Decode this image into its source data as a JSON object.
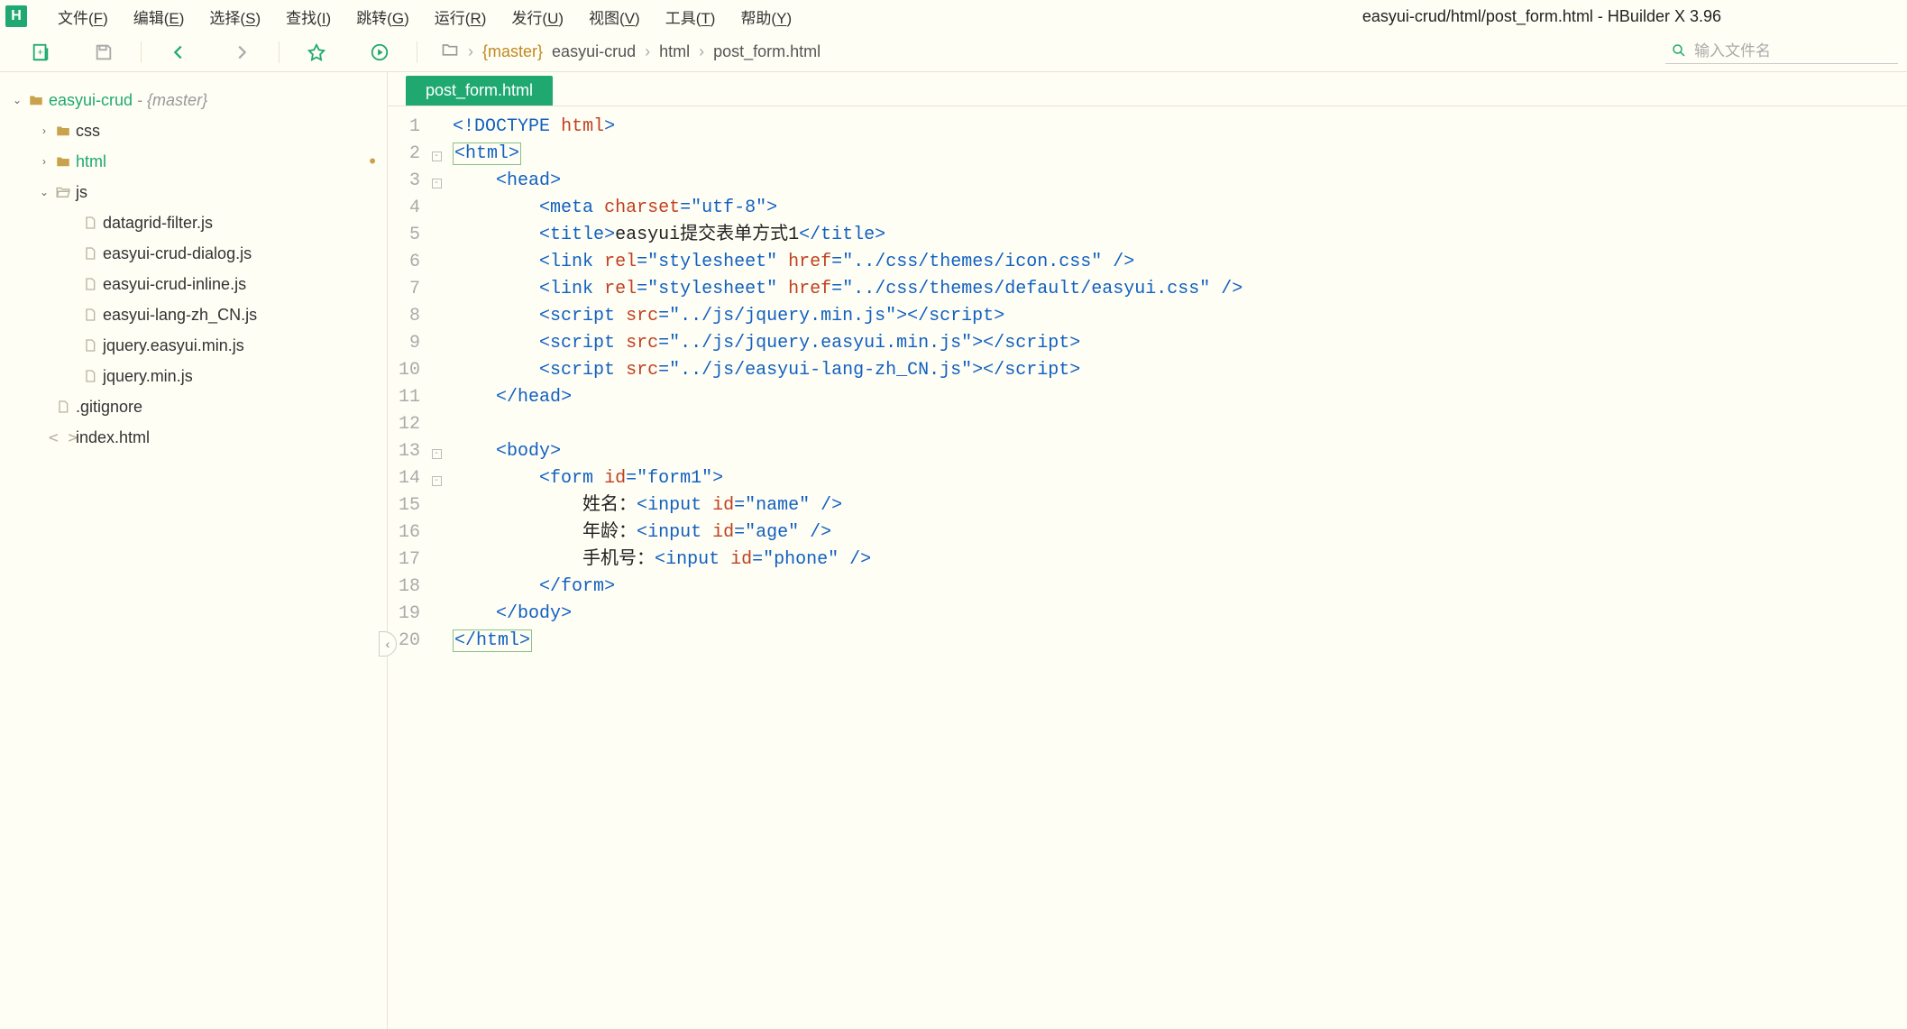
{
  "app": {
    "logo": "H"
  },
  "title": "easyui-crud/html/post_form.html - HBuilder X 3.96",
  "menu": [
    "文件(F)",
    "编辑(E)",
    "选择(S)",
    "查找(I)",
    "跳转(G)",
    "运行(R)",
    "发行(U)",
    "视图(V)",
    "工具(T)",
    "帮助(Y)"
  ],
  "search": {
    "placeholder": "输入文件名"
  },
  "breadcrumb": {
    "branch": "{master}",
    "parts": [
      "easyui-crud",
      "html",
      "post_form.html"
    ]
  },
  "tree": {
    "root": {
      "name": "easyui-crud",
      "branch": " - {master}"
    },
    "items": [
      {
        "indent": 1,
        "caret": "›",
        "icon": "folder",
        "label": "css"
      },
      {
        "indent": 1,
        "caret": "›",
        "icon": "folder",
        "label": "html",
        "selected": true,
        "modified": true
      },
      {
        "indent": 1,
        "caret": "⌄",
        "icon": "folder-open",
        "label": "js"
      },
      {
        "indent": 2,
        "caret": "",
        "icon": "file",
        "label": "datagrid-filter.js"
      },
      {
        "indent": 2,
        "caret": "",
        "icon": "file",
        "label": "easyui-crud-dialog.js"
      },
      {
        "indent": 2,
        "caret": "",
        "icon": "file",
        "label": "easyui-crud-inline.js"
      },
      {
        "indent": 2,
        "caret": "",
        "icon": "file",
        "label": "easyui-lang-zh_CN.js"
      },
      {
        "indent": 2,
        "caret": "",
        "icon": "file",
        "label": "jquery.easyui.min.js"
      },
      {
        "indent": 2,
        "caret": "",
        "icon": "file",
        "label": "jquery.min.js"
      },
      {
        "indent": 1,
        "caret": "",
        "icon": "file",
        "label": ".gitignore"
      },
      {
        "indent": 1,
        "caret": "",
        "icon": "code",
        "label": "index.html"
      }
    ]
  },
  "tab": {
    "label": "post_form.html"
  },
  "code": {
    "lines": [
      {
        "n": 1,
        "fold": "",
        "html": "<span class='tok-punc'>&lt;!</span><span class='tok-doctype'>DOCTYPE</span> <span class='tok-doctype-kw'>html</span><span class='tok-punc'>&gt;</span>"
      },
      {
        "n": 2,
        "fold": "⊟",
        "html": "<span class='hl-box'><span class='tok-punc'>&lt;</span><span class='tok-tag'>html</span><span class='tok-punc'>&gt;</span></span>"
      },
      {
        "n": 3,
        "fold": "⊟",
        "html": "    <span class='tok-punc'>&lt;</span><span class='tok-tag'>head</span><span class='tok-punc'>&gt;</span>"
      },
      {
        "n": 4,
        "fold": "",
        "html": "        <span class='tok-punc'>&lt;</span><span class='tok-tag'>meta</span> <span class='tok-attr'>charset</span><span class='tok-punc'>=</span><span class='tok-val'>\"utf-8\"</span><span class='tok-punc'>&gt;</span>"
      },
      {
        "n": 5,
        "fold": "",
        "html": "        <span class='tok-punc'>&lt;</span><span class='tok-tag'>title</span><span class='tok-punc'>&gt;</span><span class='tok-text'>easyui提交表单方式1</span><span class='tok-punc'>&lt;/</span><span class='tok-tag'>title</span><span class='tok-punc'>&gt;</span>"
      },
      {
        "n": 6,
        "fold": "",
        "html": "        <span class='tok-punc'>&lt;</span><span class='tok-tag'>link</span> <span class='tok-attr'>rel</span><span class='tok-punc'>=</span><span class='tok-val'>\"stylesheet\"</span> <span class='tok-attr'>href</span><span class='tok-punc'>=</span><span class='tok-val'>\"../css/themes/icon.css\"</span> <span class='tok-punc'>/&gt;</span>"
      },
      {
        "n": 7,
        "fold": "",
        "html": "        <span class='tok-punc'>&lt;</span><span class='tok-tag'>link</span> <span class='tok-attr'>rel</span><span class='tok-punc'>=</span><span class='tok-val'>\"stylesheet\"</span> <span class='tok-attr'>href</span><span class='tok-punc'>=</span><span class='tok-val'>\"../css/themes/default/easyui.css\"</span> <span class='tok-punc'>/&gt;</span>"
      },
      {
        "n": 8,
        "fold": "",
        "html": "        <span class='tok-punc'>&lt;</span><span class='tok-tag'>script</span> <span class='tok-attr'>src</span><span class='tok-punc'>=</span><span class='tok-val'>\"../js/jquery.min.js\"</span><span class='tok-punc'>&gt;&lt;/</span><span class='tok-tag'>script</span><span class='tok-punc'>&gt;</span>"
      },
      {
        "n": 9,
        "fold": "",
        "html": "        <span class='tok-punc'>&lt;</span><span class='tok-tag'>script</span> <span class='tok-attr'>src</span><span class='tok-punc'>=</span><span class='tok-val'>\"../js/jquery.easyui.min.js\"</span><span class='tok-punc'>&gt;&lt;/</span><span class='tok-tag'>script</span><span class='tok-punc'>&gt;</span>"
      },
      {
        "n": 10,
        "fold": "",
        "html": "        <span class='tok-punc'>&lt;</span><span class='tok-tag'>script</span> <span class='tok-attr'>src</span><span class='tok-punc'>=</span><span class='tok-val'>\"../js/easyui-lang-zh_CN.js\"</span><span class='tok-punc'>&gt;&lt;/</span><span class='tok-tag'>script</span><span class='tok-punc'>&gt;</span>"
      },
      {
        "n": 11,
        "fold": "",
        "html": "    <span class='tok-punc'>&lt;/</span><span class='tok-tag'>head</span><span class='tok-punc'>&gt;</span>"
      },
      {
        "n": 12,
        "fold": "",
        "html": ""
      },
      {
        "n": 13,
        "fold": "⊟",
        "html": "    <span class='tok-punc'>&lt;</span><span class='tok-tag'>body</span><span class='tok-punc'>&gt;</span>"
      },
      {
        "n": 14,
        "fold": "⊟",
        "html": "        <span class='tok-punc'>&lt;</span><span class='tok-tag'>form</span> <span class='tok-attr'>id</span><span class='tok-punc'>=</span><span class='tok-val'>\"form1\"</span><span class='tok-punc'>&gt;</span>"
      },
      {
        "n": 15,
        "fold": "",
        "html": "            <span class='tok-text'>姓名：</span><span class='tok-punc'>&lt;</span><span class='tok-tag'>input</span> <span class='tok-attr'>id</span><span class='tok-punc'>=</span><span class='tok-val'>\"name\"</span> <span class='tok-punc'>/&gt;</span>"
      },
      {
        "n": 16,
        "fold": "",
        "html": "            <span class='tok-text'>年龄：</span><span class='tok-punc'>&lt;</span><span class='tok-tag'>input</span> <span class='tok-attr'>id</span><span class='tok-punc'>=</span><span class='tok-val'>\"age\"</span> <span class='tok-punc'>/&gt;</span>"
      },
      {
        "n": 17,
        "fold": "",
        "html": "            <span class='tok-text'>手机号：</span><span class='tok-punc'>&lt;</span><span class='tok-tag'>input</span> <span class='tok-attr'>id</span><span class='tok-punc'>=</span><span class='tok-val'>\"phone\"</span> <span class='tok-punc'>/&gt;</span>"
      },
      {
        "n": 18,
        "fold": "",
        "html": "        <span class='tok-punc'>&lt;/</span><span class='tok-tag'>form</span><span class='tok-punc'>&gt;</span>"
      },
      {
        "n": 19,
        "fold": "",
        "html": "    <span class='tok-punc'>&lt;/</span><span class='tok-tag'>body</span><span class='tok-punc'>&gt;</span>"
      },
      {
        "n": 20,
        "fold": "",
        "html": "<span class='hl-box'><span class='tok-punc'>&lt;/</span><span class='tok-tag'>html</span><span class='tok-punc'>&gt;</span></span>"
      }
    ]
  }
}
